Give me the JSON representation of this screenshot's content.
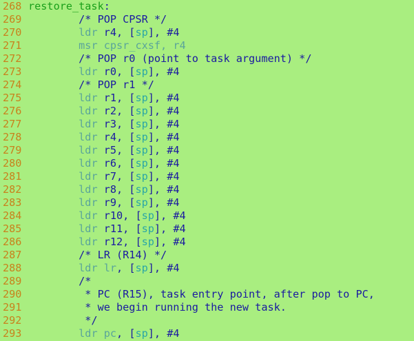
{
  "editor": {
    "background": "#a9ee80",
    "colors": {
      "line_number": "#c8821c",
      "label": "#1aa01a",
      "comment": "#1a1aa0",
      "mnemonic": "#5aa59a",
      "register": "#1a1aa0",
      "stack_pointer": "#2aa6a6"
    },
    "lines": [
      {
        "num": "268",
        "tokens": [
          {
            "t": "restore_task",
            "c": "label"
          },
          {
            "t": ":",
            "c": "plain"
          }
        ]
      },
      {
        "num": "269",
        "tokens": [
          {
            "t": "        /* POP CPSR */",
            "c": "comment"
          }
        ]
      },
      {
        "num": "270",
        "tokens": [
          {
            "t": "        ",
            "c": "plain"
          },
          {
            "t": "ldr",
            "c": "op"
          },
          {
            "t": " r4, [",
            "c": "plain"
          },
          {
            "t": "sp",
            "c": "mem"
          },
          {
            "t": "], #4",
            "c": "plain"
          }
        ]
      },
      {
        "num": "271",
        "tokens": [
          {
            "t": "        ",
            "c": "plain"
          },
          {
            "t": "msr",
            "c": "op"
          },
          {
            "t": " ",
            "c": "plain"
          },
          {
            "t": "cpsr_cxsf",
            "c": "op"
          },
          {
            "t": ", r4",
            "c": "op"
          }
        ]
      },
      {
        "num": "272",
        "tokens": [
          {
            "t": "        /* POP r0 (point to task argument) */",
            "c": "comment"
          }
        ]
      },
      {
        "num": "273",
        "tokens": [
          {
            "t": "        ",
            "c": "plain"
          },
          {
            "t": "ldr",
            "c": "op"
          },
          {
            "t": " r0, [",
            "c": "plain"
          },
          {
            "t": "sp",
            "c": "mem"
          },
          {
            "t": "], #4",
            "c": "plain"
          }
        ]
      },
      {
        "num": "274",
        "tokens": [
          {
            "t": "        /* POP r1 */",
            "c": "comment"
          }
        ]
      },
      {
        "num": "275",
        "tokens": [
          {
            "t": "        ",
            "c": "plain"
          },
          {
            "t": "ldr",
            "c": "op"
          },
          {
            "t": " r1, [",
            "c": "plain"
          },
          {
            "t": "sp",
            "c": "mem"
          },
          {
            "t": "], #4",
            "c": "plain"
          }
        ]
      },
      {
        "num": "276",
        "tokens": [
          {
            "t": "        ",
            "c": "plain"
          },
          {
            "t": "ldr",
            "c": "op"
          },
          {
            "t": " r2, [",
            "c": "plain"
          },
          {
            "t": "sp",
            "c": "mem"
          },
          {
            "t": "], #4",
            "c": "plain"
          }
        ]
      },
      {
        "num": "277",
        "tokens": [
          {
            "t": "        ",
            "c": "plain"
          },
          {
            "t": "ldr",
            "c": "op"
          },
          {
            "t": " r3, [",
            "c": "plain"
          },
          {
            "t": "sp",
            "c": "mem"
          },
          {
            "t": "], #4",
            "c": "plain"
          }
        ]
      },
      {
        "num": "278",
        "tokens": [
          {
            "t": "        ",
            "c": "plain"
          },
          {
            "t": "ldr",
            "c": "op"
          },
          {
            "t": " r4, [",
            "c": "plain"
          },
          {
            "t": "sp",
            "c": "mem"
          },
          {
            "t": "], #4",
            "c": "plain"
          }
        ]
      },
      {
        "num": "279",
        "tokens": [
          {
            "t": "        ",
            "c": "plain"
          },
          {
            "t": "ldr",
            "c": "op"
          },
          {
            "t": " r5, [",
            "c": "plain"
          },
          {
            "t": "sp",
            "c": "mem"
          },
          {
            "t": "], #4",
            "c": "plain"
          }
        ]
      },
      {
        "num": "280",
        "tokens": [
          {
            "t": "        ",
            "c": "plain"
          },
          {
            "t": "ldr",
            "c": "op"
          },
          {
            "t": " r6, [",
            "c": "plain"
          },
          {
            "t": "sp",
            "c": "mem"
          },
          {
            "t": "], #4",
            "c": "plain"
          }
        ]
      },
      {
        "num": "281",
        "tokens": [
          {
            "t": "        ",
            "c": "plain"
          },
          {
            "t": "ldr",
            "c": "op"
          },
          {
            "t": " r7, [",
            "c": "plain"
          },
          {
            "t": "sp",
            "c": "mem"
          },
          {
            "t": "], #4",
            "c": "plain"
          }
        ]
      },
      {
        "num": "282",
        "tokens": [
          {
            "t": "        ",
            "c": "plain"
          },
          {
            "t": "ldr",
            "c": "op"
          },
          {
            "t": " r8, [",
            "c": "plain"
          },
          {
            "t": "sp",
            "c": "mem"
          },
          {
            "t": "], #4",
            "c": "plain"
          }
        ]
      },
      {
        "num": "283",
        "tokens": [
          {
            "t": "        ",
            "c": "plain"
          },
          {
            "t": "ldr",
            "c": "op"
          },
          {
            "t": " r9, [",
            "c": "plain"
          },
          {
            "t": "sp",
            "c": "mem"
          },
          {
            "t": "], #4",
            "c": "plain"
          }
        ]
      },
      {
        "num": "284",
        "tokens": [
          {
            "t": "        ",
            "c": "plain"
          },
          {
            "t": "ldr",
            "c": "op"
          },
          {
            "t": " r10, [",
            "c": "plain"
          },
          {
            "t": "sp",
            "c": "mem"
          },
          {
            "t": "], #4",
            "c": "plain"
          }
        ]
      },
      {
        "num": "285",
        "tokens": [
          {
            "t": "        ",
            "c": "plain"
          },
          {
            "t": "ldr",
            "c": "op"
          },
          {
            "t": " r11, [",
            "c": "plain"
          },
          {
            "t": "sp",
            "c": "mem"
          },
          {
            "t": "], #4",
            "c": "plain"
          }
        ]
      },
      {
        "num": "286",
        "tokens": [
          {
            "t": "        ",
            "c": "plain"
          },
          {
            "t": "ldr",
            "c": "op"
          },
          {
            "t": " r12, [",
            "c": "plain"
          },
          {
            "t": "sp",
            "c": "mem"
          },
          {
            "t": "], #4",
            "c": "plain"
          }
        ]
      },
      {
        "num": "287",
        "tokens": [
          {
            "t": "        /* LR (R14) */",
            "c": "comment"
          }
        ]
      },
      {
        "num": "288",
        "tokens": [
          {
            "t": "        ",
            "c": "plain"
          },
          {
            "t": "ldr",
            "c": "op"
          },
          {
            "t": " ",
            "c": "plain"
          },
          {
            "t": "lr",
            "c": "op"
          },
          {
            "t": ", [",
            "c": "plain"
          },
          {
            "t": "sp",
            "c": "mem"
          },
          {
            "t": "], #4",
            "c": "plain"
          }
        ]
      },
      {
        "num": "289",
        "tokens": [
          {
            "t": "        /*",
            "c": "comment"
          }
        ]
      },
      {
        "num": "290",
        "tokens": [
          {
            "t": "         * PC (R15), task entry point, after pop to PC,",
            "c": "comment"
          }
        ]
      },
      {
        "num": "291",
        "tokens": [
          {
            "t": "         * we begin running the new task.",
            "c": "comment"
          }
        ]
      },
      {
        "num": "292",
        "tokens": [
          {
            "t": "         */",
            "c": "comment"
          }
        ]
      },
      {
        "num": "293",
        "tokens": [
          {
            "t": "        ",
            "c": "plain"
          },
          {
            "t": "ldr",
            "c": "op"
          },
          {
            "t": " ",
            "c": "plain"
          },
          {
            "t": "pc",
            "c": "op"
          },
          {
            "t": ", [",
            "c": "plain"
          },
          {
            "t": "sp",
            "c": "mem"
          },
          {
            "t": "], #4",
            "c": "plain"
          }
        ]
      }
    ]
  }
}
